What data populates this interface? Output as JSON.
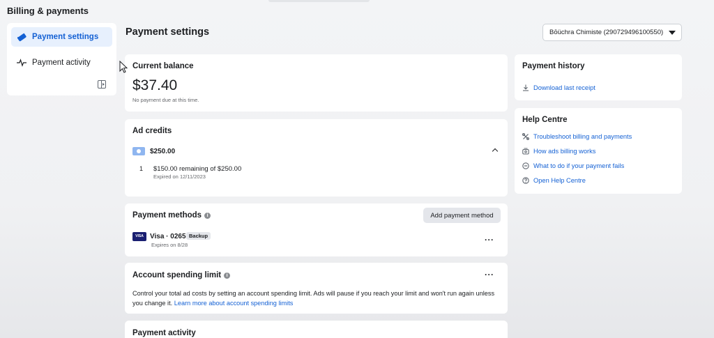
{
  "header": {
    "title": "Billing & payments"
  },
  "sidebar": {
    "items": [
      {
        "label": "Payment settings",
        "icon": "card-icon",
        "active": true
      },
      {
        "label": "Payment activity",
        "icon": "pulse-icon",
        "active": false
      }
    ]
  },
  "main": {
    "title": "Payment settings",
    "account_select": {
      "value": "Bōüchra Chimiste (290729496100550)"
    },
    "current_balance": {
      "title": "Current balance",
      "amount": "$37.40",
      "note": "No payment due at this time."
    },
    "ad_credits": {
      "title": "Ad credits",
      "total": "$250.00",
      "items": [
        {
          "index": "1",
          "remaining": "$150.00 remaining of $250.00",
          "expiry": "Expired on 12/11/2023"
        }
      ]
    },
    "payment_methods": {
      "title": "Payment methods",
      "add_label": "Add payment method",
      "card": {
        "brand": "VISA",
        "label": "Visa · 0265",
        "badge": "Backup",
        "expiry": "Expires on 8/28"
      }
    },
    "spending_limit": {
      "title": "Account spending limit",
      "text": "Control your total ad costs by setting an account spending limit. Ads will pause if you reach your limit and won't run again unless you change it.",
      "link": "Learn more about account spending limits"
    },
    "payment_activity": {
      "title": "Payment activity"
    }
  },
  "right": {
    "payment_history": {
      "title": "Payment history",
      "link": "Download last receipt"
    },
    "help_centre": {
      "title": "Help Centre",
      "links": [
        {
          "label": "Troubleshoot billing and payments",
          "icon": "tools-icon"
        },
        {
          "label": "How ads billing works",
          "icon": "wallet-icon"
        },
        {
          "label": "What to do if your payment fails",
          "icon": "minus-circle-icon"
        },
        {
          "label": "Open Help Centre",
          "icon": "question-icon"
        }
      ]
    }
  },
  "more_label": "···",
  "info_glyph": "i",
  "colors": {
    "accent": "#1461d4",
    "active_bg": "#e7f0fd",
    "card_bg": "#ffffff",
    "page_bg": "#f0f1f3"
  }
}
